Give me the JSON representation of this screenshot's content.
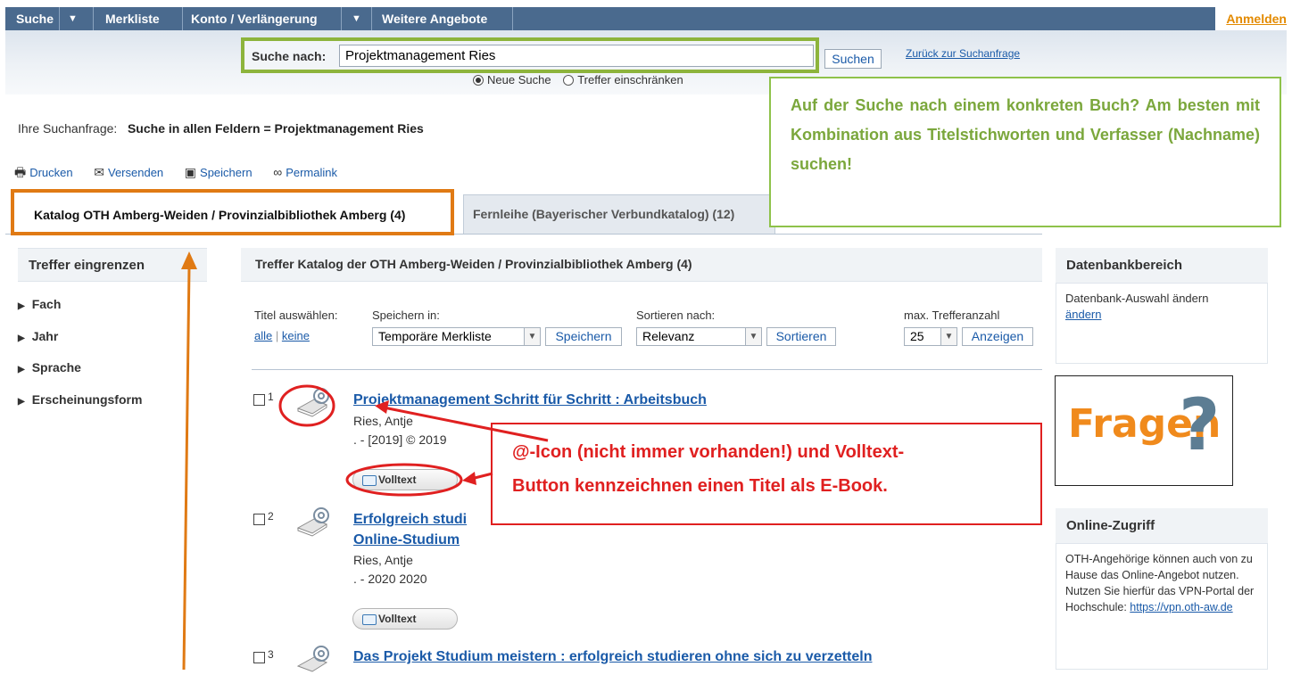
{
  "nav": {
    "items": [
      "Suche",
      "Merkliste",
      "Konto / Verlängerung",
      "Weitere Angebote"
    ],
    "login": "Anmelden"
  },
  "search": {
    "label": "Suche nach:",
    "value": "Projektmanagement Ries",
    "button": "Suchen",
    "back_link": "Zurück zur Suchanfrage",
    "radio_new": "Neue Suche",
    "radio_filter": "Treffer einschränken"
  },
  "query": {
    "label": "Ihre Suchanfrage:",
    "value": "Suche in allen Feldern = Projektmanagement Ries"
  },
  "actions": [
    "Drucken",
    "Versenden",
    "Speichern",
    "Permalink"
  ],
  "tabs": [
    "Katalog OTH Amberg-Weiden / Provinzialbibliothek Amberg (4)",
    "Fernleihe (Bayerischer Verbundkatalog) (12)"
  ],
  "tip": "Auf der Suche nach einem konkreten Buch? Am besten mit Kombination aus Titelstichworten und Verfasser (Nachname) suchen!",
  "left": {
    "title": "Treffer eingrenzen",
    "facets": [
      "Fach",
      "Jahr",
      "Sprache",
      "Erscheinungsform"
    ]
  },
  "main": {
    "title": "Treffer Katalog der OTH Amberg-Weiden / Provinzialbibliothek Amberg (4)",
    "select_label": "Titel auswählen:",
    "all": "alle",
    "none": "keine",
    "save_label": "Speichern in:",
    "save_value": "Temporäre Merkliste",
    "save_button": "Speichern",
    "sort_label": "Sortieren nach:",
    "sort_value": "Relevanz",
    "sort_button": "Sortieren",
    "max_label": "max. Trefferanzahl",
    "max_value": "25",
    "max_button": "Anzeigen",
    "volltext": "Volltext"
  },
  "results": [
    {
      "num": "1",
      "title": "Projektmanagement Schritt für Schritt : Arbeitsbuch",
      "author": "Ries, Antje",
      "year": ". - [2019] © 2019"
    },
    {
      "num": "2",
      "title_a": "Erfolgreich studi",
      "title_b": "Online-Studium",
      "author": "Ries, Antje",
      "year": ". - 2020 2020"
    },
    {
      "num": "3",
      "title": "Das Projekt Studium meistern : erfolgreich studieren ohne sich zu verzetteln"
    }
  ],
  "callout": {
    "line1": "@-Icon (nicht immer vorhanden!) und Volltext-",
    "line2": "Button kennzeichnen einen Titel als E-Book."
  },
  "right": {
    "db_title": "Datenbankbereich",
    "db_text": "Datenbank-Auswahl ändern",
    "db_link": "ändern",
    "fragen": "Fragen",
    "fragen_mark": "?",
    "online_title": "Online-Zugriff",
    "online_text": "OTH-Angehörige können auch von zu Hause das Online-Angebot nutzen. Nutzen Sie hierfür das VPN-Portal der Hochschule:",
    "online_link": "https://vpn.oth-aw.de"
  },
  "colors": {
    "nav": "#4a6a8e",
    "login": "#e38a00",
    "tip": "#7ba73c",
    "callout": "#e02020",
    "tab_highlight": "#e07a14"
  }
}
